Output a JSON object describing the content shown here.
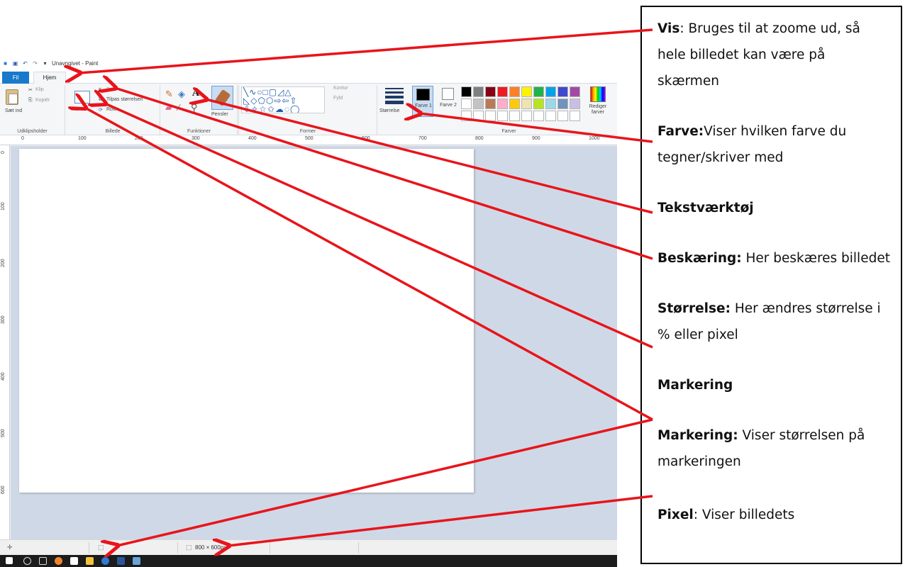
{
  "window": {
    "title": "Unavngivet - Paint",
    "tabs": [
      "Fil",
      "Hjem"
    ]
  },
  "ribbon": {
    "clipboard": {
      "paste_label": "Sæt ind",
      "cut_label": "Klip",
      "copy_label": "Kopiér",
      "group_label": "Udklipsholder"
    },
    "image": {
      "select_label": "Ma",
      "crop_label": "Bes",
      "resize_label": "Tilpas størrelsen",
      "rotate_label": "Roter",
      "group_label": "Billede"
    },
    "tools": {
      "group_label": "Funktioner"
    },
    "brushes_label": "Pensler",
    "shapes": {
      "outline_label": "Kontur",
      "fill_label": "Fyld",
      "group_label": "Former"
    },
    "size_label": "Størrelse",
    "color1_label": "Farve 1",
    "color2_label": "Farve 2",
    "edit_colors_label": "Rediger farver",
    "colors_group_label": "Farver",
    "palette_row1": [
      "#000000",
      "#7f7f7f",
      "#880015",
      "#ed1c24",
      "#ff7f27",
      "#fff200",
      "#22b14c",
      "#00a2e8",
      "#3f48cc",
      "#a349a4"
    ],
    "palette_row2": [
      "#ffffff",
      "#c3c3c3",
      "#b97a57",
      "#ffaec9",
      "#ffc90e",
      "#efe4b0",
      "#b5e61d",
      "#99d9ea",
      "#7092be",
      "#c8bfe7"
    ]
  },
  "ruler_h_ticks": [
    "0",
    "100",
    "200",
    "300",
    "400",
    "500",
    "600",
    "700",
    "800",
    "900",
    "1000"
  ],
  "ruler_v_ticks": [
    "0",
    "100",
    "200",
    "300",
    "400",
    "500",
    "600"
  ],
  "statusbar": {
    "pixel_size": "800 × 600px"
  },
  "annotations": [
    {
      "term": "Vis",
      "sep": ": ",
      "text": "Bruges til at zoome ud, så hele billedet kan være på skærmen"
    },
    {
      "term": "Farve:",
      "sep": "",
      "text": "Viser hvilken farve du tegner/skriver med"
    },
    {
      "term": "Tekstværktøj",
      "sep": "",
      "text": ""
    },
    {
      "term": "Beskæring:",
      "sep": " ",
      "text": "Her beskæres billedet"
    },
    {
      "term": "Størrelse:",
      "sep": " ",
      "text": "Her ændres størrelse i % eller pixel"
    },
    {
      "term": "Markering",
      "sep": "",
      "text": ""
    },
    {
      "term": "Markering:",
      "sep": " ",
      "text": "Viser størrelsen på markeringen"
    },
    {
      "term": "Pixel",
      "sep": ": ",
      "text": "Viser billedets"
    }
  ],
  "colors": {
    "arrow": "#e8141b",
    "accent_tab": "#1979ca",
    "workspace": "#cfd8e6"
  }
}
